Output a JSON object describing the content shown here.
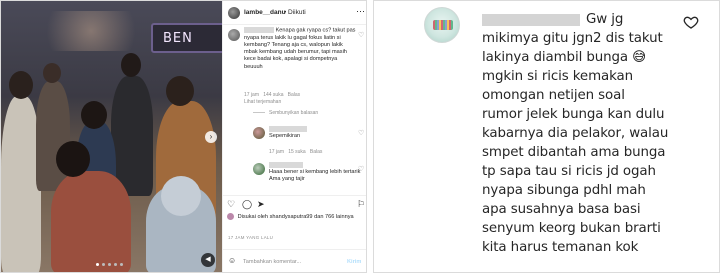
{
  "left_post": {
    "photo_sign": "BEN",
    "header": {
      "username": "lambe__danu",
      "separator": "•",
      "follow_label": "Diikuti",
      "more_icon": "more-icon"
    },
    "comment1": {
      "text": "Kenapa gak ryapa cs? takut pas nyapa terus lakik lu gagal fokus liatin si kembang? Tenang aja cs, walopun lakik mbak kembang udah berumur, tapi masih kece badai kok, apalagi si dompetnya beuuuh",
      "time": "17 jam",
      "likes": "144 suka",
      "reply": "Balas",
      "see_translation": "Lihat terjemahan"
    },
    "hide_replies": "Sembunyikan balasan",
    "reply1": {
      "text": "Sepemikiran",
      "time": "17 jam",
      "likes": "15 suka",
      "reply": "Balas"
    },
    "reply2": {
      "text": "Haaa bener si kembang lebih tertarik Ama yang tajir"
    },
    "likes_text_pre": "Disukai oleh",
    "likes_user": "shandysaputra99",
    "likes_text_post": "dan",
    "likes_count": "766 lainnya",
    "post_time": "17 JAM YANG LALU",
    "add_comment_placeholder": "Tambahkan komentar...",
    "send_label": "Kirim"
  },
  "right_comment": {
    "lines": [
      "Gw jg",
      "mikimya gitu jgn2 dis takut",
      "lakinya diambil bunga 😅",
      "mgkin si ricis kemakan",
      "omongan netijen soal",
      "rumor jelek bunga kan dulu",
      "kabarnya dia pelakor, walau",
      "smpet dibantah ama bunga",
      "tp sapa tau si ricis jd ogah",
      "nyapa sibunga pdhl mah",
      "apa susahnya basa basi",
      "senyum keorg bukan brarti",
      "kita harus temanan kok"
    ]
  },
  "colors": {
    "ig_text": "#262626",
    "ig_muted": "#8e8e8e",
    "redaction": "#d4d4d4",
    "send_disabled": "#b2dffc"
  }
}
